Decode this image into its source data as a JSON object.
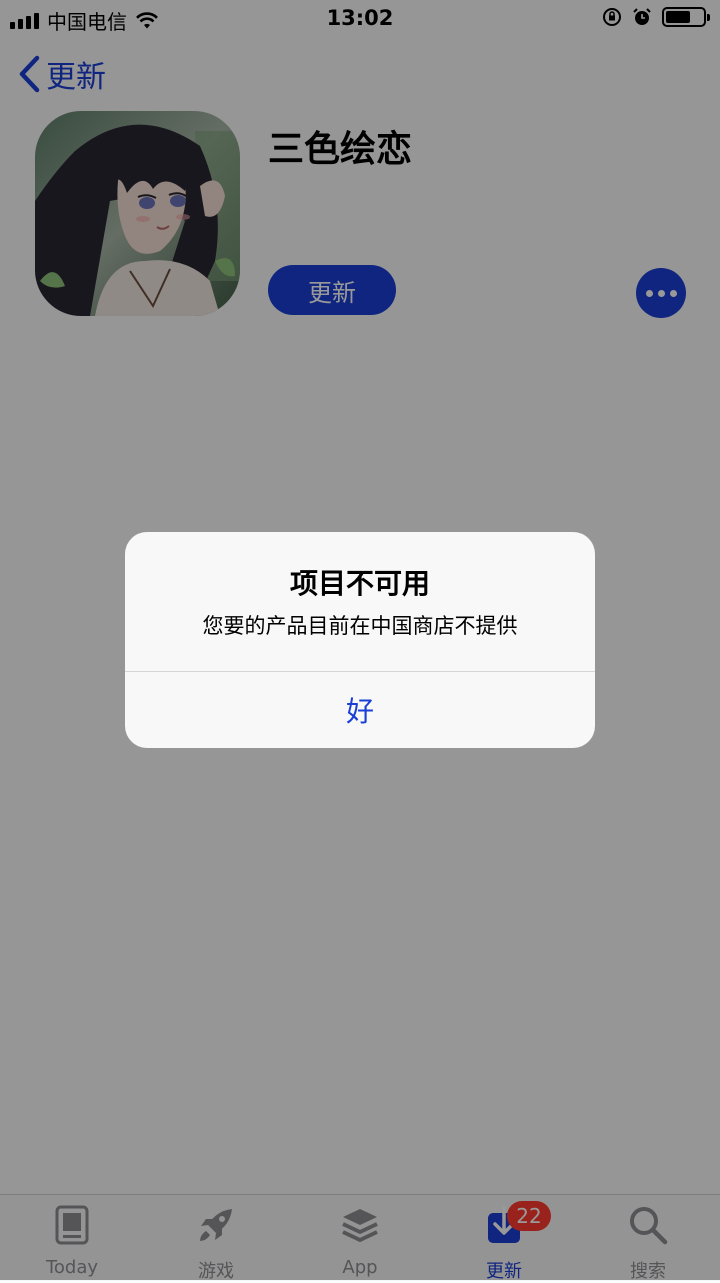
{
  "status_bar": {
    "carrier": "中国电信",
    "time": "13:02"
  },
  "nav": {
    "back_label": "更新"
  },
  "app": {
    "title": "三色绘恋",
    "update_label": "更新",
    "more_icon": "ellipsis-icon"
  },
  "alert": {
    "title": "项目不可用",
    "message": "您要的产品目前在中国商店不提供",
    "ok_label": "好"
  },
  "tabbar": {
    "items": [
      {
        "label": "Today",
        "icon": "today-icon"
      },
      {
        "label": "游戏",
        "icon": "rocket-icon"
      },
      {
        "label": "App",
        "icon": "layers-icon"
      },
      {
        "label": "更新",
        "icon": "download-icon",
        "badge": "22",
        "active": true
      },
      {
        "label": "搜索",
        "icon": "search-icon"
      }
    ]
  },
  "colors": {
    "accent": "#1a3fd6",
    "badge": "#ff3b30",
    "overlay": "rgba(0,0,0,0.40)"
  }
}
